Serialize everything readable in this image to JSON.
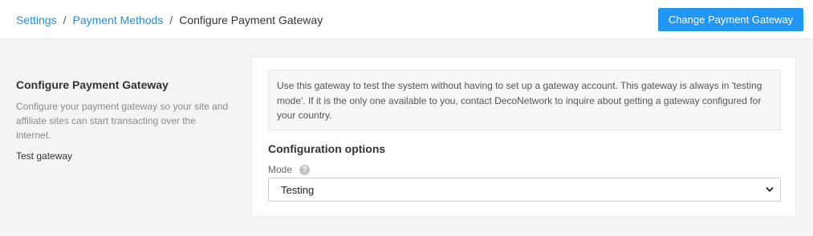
{
  "breadcrumb": {
    "items": [
      "Settings",
      "Payment Methods"
    ],
    "current": "Configure Payment Gateway",
    "separator": "/"
  },
  "header": {
    "change_button_label": "Change Payment Gateway"
  },
  "left_panel": {
    "title": "Configure Payment Gateway",
    "description": "Configure your payment gateway so your site and affiliate sites can start transacting over the internet.",
    "gateway_name": "Test gateway"
  },
  "main": {
    "info_text": "Use this gateway to test the system without having to set up a gateway account. This gateway is always in 'testing mode'. If it is the only one available to you, contact DecoNetwork to inquire about getting a gateway configured for your country.",
    "config_title": "Configuration options",
    "mode_label": "Mode",
    "mode_value": "Testing",
    "help_icon": "?"
  },
  "colors": {
    "link": "#1a8fe3",
    "primary_button": "#2196f3",
    "page_background": "#f4f4f4"
  },
  "icons": {
    "help": "help-icon",
    "dropdown": "chevron-down-icon"
  }
}
